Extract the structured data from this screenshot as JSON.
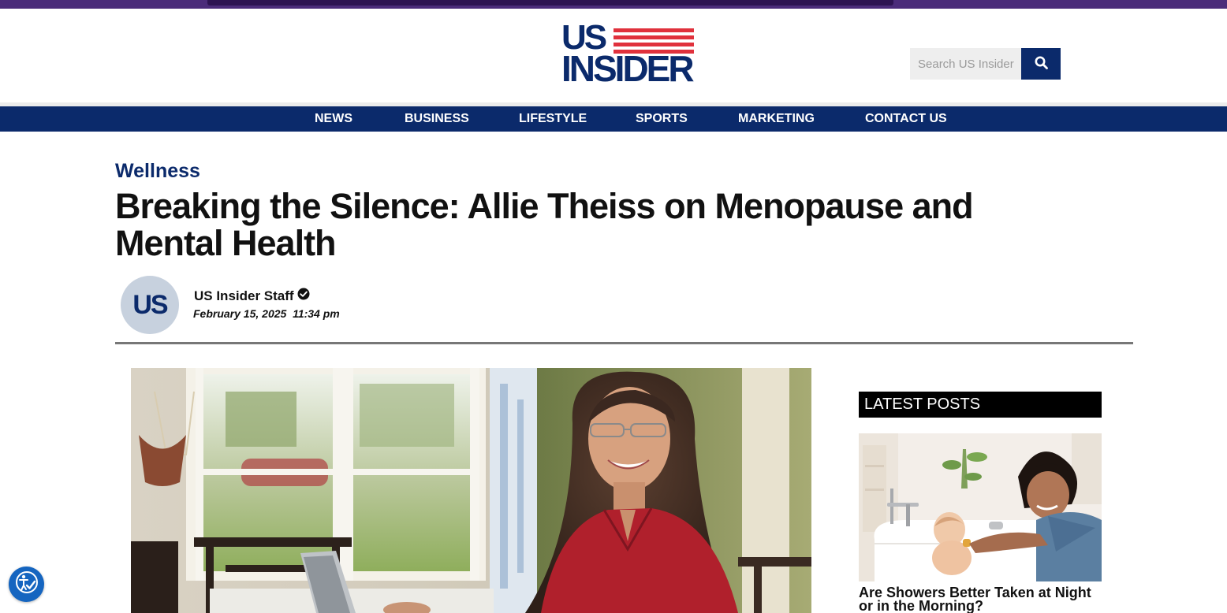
{
  "site": {
    "logo_top": "US",
    "logo_bottom": "INSIDER",
    "brand_color": "#0b2a6b",
    "accent_color": "#e0313c"
  },
  "search": {
    "placeholder": "Search US Insider",
    "icon": "search-icon"
  },
  "nav": {
    "items": [
      {
        "label": "NEWS"
      },
      {
        "label": "BUSINESS"
      },
      {
        "label": "LIFESTYLE"
      },
      {
        "label": "SPORTS"
      },
      {
        "label": "MARKETING"
      },
      {
        "label": "CONTACT US"
      }
    ]
  },
  "article": {
    "category": "Wellness",
    "title": "Breaking the Silence: Allie Theiss on Menopause and Mental Health",
    "author": {
      "initials": "US",
      "name": "US Insider Staff",
      "verified_icon": "verified-check-icon"
    },
    "date": "February 15, 2025  11:34 pm"
  },
  "sidebar": {
    "latest_posts_title": "LATEST POSTS",
    "posts": [
      {
        "title": "Are Showers Better Taken at Night or in the Morning?"
      }
    ]
  },
  "accessibility": {
    "icon": "accessibility-icon"
  }
}
